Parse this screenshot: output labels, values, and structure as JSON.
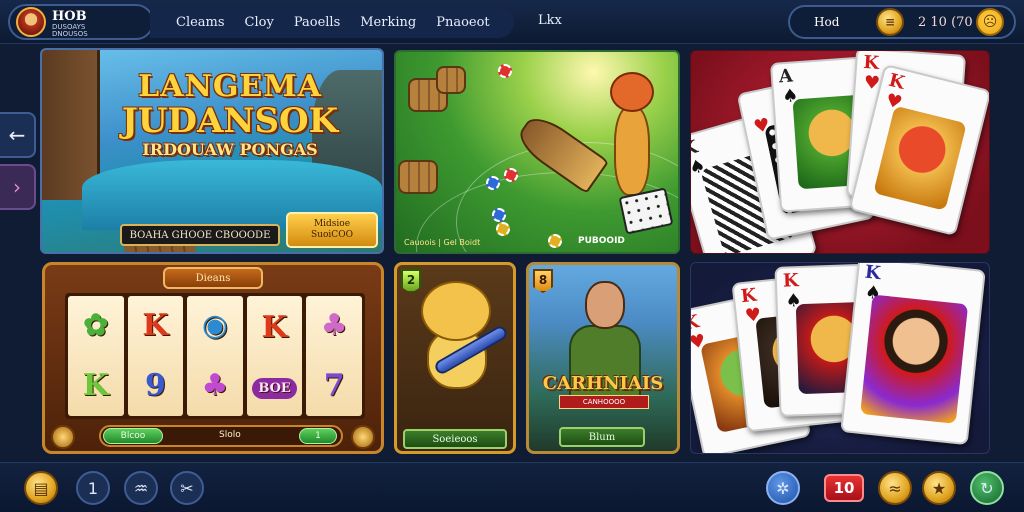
{
  "header": {
    "brand_name": "HOB",
    "brand_sub": "DUSOAYS\nDNOUSOS",
    "nav": [
      "Cleams",
      "Cloy",
      "Paoells",
      "Merking",
      "Pnaoeot"
    ],
    "nav_extra": "Lkx",
    "wallet_label": "Hod",
    "balance": "2 10 (70"
  },
  "cards": {
    "c1": {
      "title_1": "LANGEMA",
      "title_2": "JUDANSOK",
      "title_3": "IRDOUAW PONGAS",
      "btn_1": "BOAHA GHOOE CBOOODE",
      "btn_2": "Midsioe\nSuoiCOO"
    },
    "c2": {
      "caption_1": "Cauoois | Gel Boidt",
      "caption_2": "PUBOOID"
    },
    "c4": {
      "header": "Dieans",
      "symbols_row1": [
        "",
        "K",
        "",
        "K",
        ""
      ],
      "symbols_row2": [
        "K",
        "9",
        "",
        "BOE",
        "7"
      ],
      "left_pill": "Blcoo",
      "mid_text": "Slolo",
      "right_pill": "1"
    },
    "c5": {
      "badge": "2",
      "button": "Soeieoos"
    },
    "c6": {
      "badge": "8",
      "title": "CARHNIAIS",
      "ribbon": "CANHOOOO",
      "button": "Blum"
    },
    "c3": {
      "cards": [
        {
          "rank": "K"
        },
        {
          "rank": "A"
        },
        {
          "rank": "K"
        },
        {
          "rank": "K"
        }
      ]
    },
    "c7": {
      "cards": [
        {
          "rank": "K"
        },
        {
          "rank": "K"
        },
        {
          "rank": "K"
        },
        {
          "rank": "K"
        }
      ]
    }
  },
  "bottom": {
    "counter": "10",
    "btn_2": "1"
  },
  "colors": {
    "accent_gold": "#e0a421",
    "bg": "#0f1c33",
    "red": "#c4243a"
  }
}
